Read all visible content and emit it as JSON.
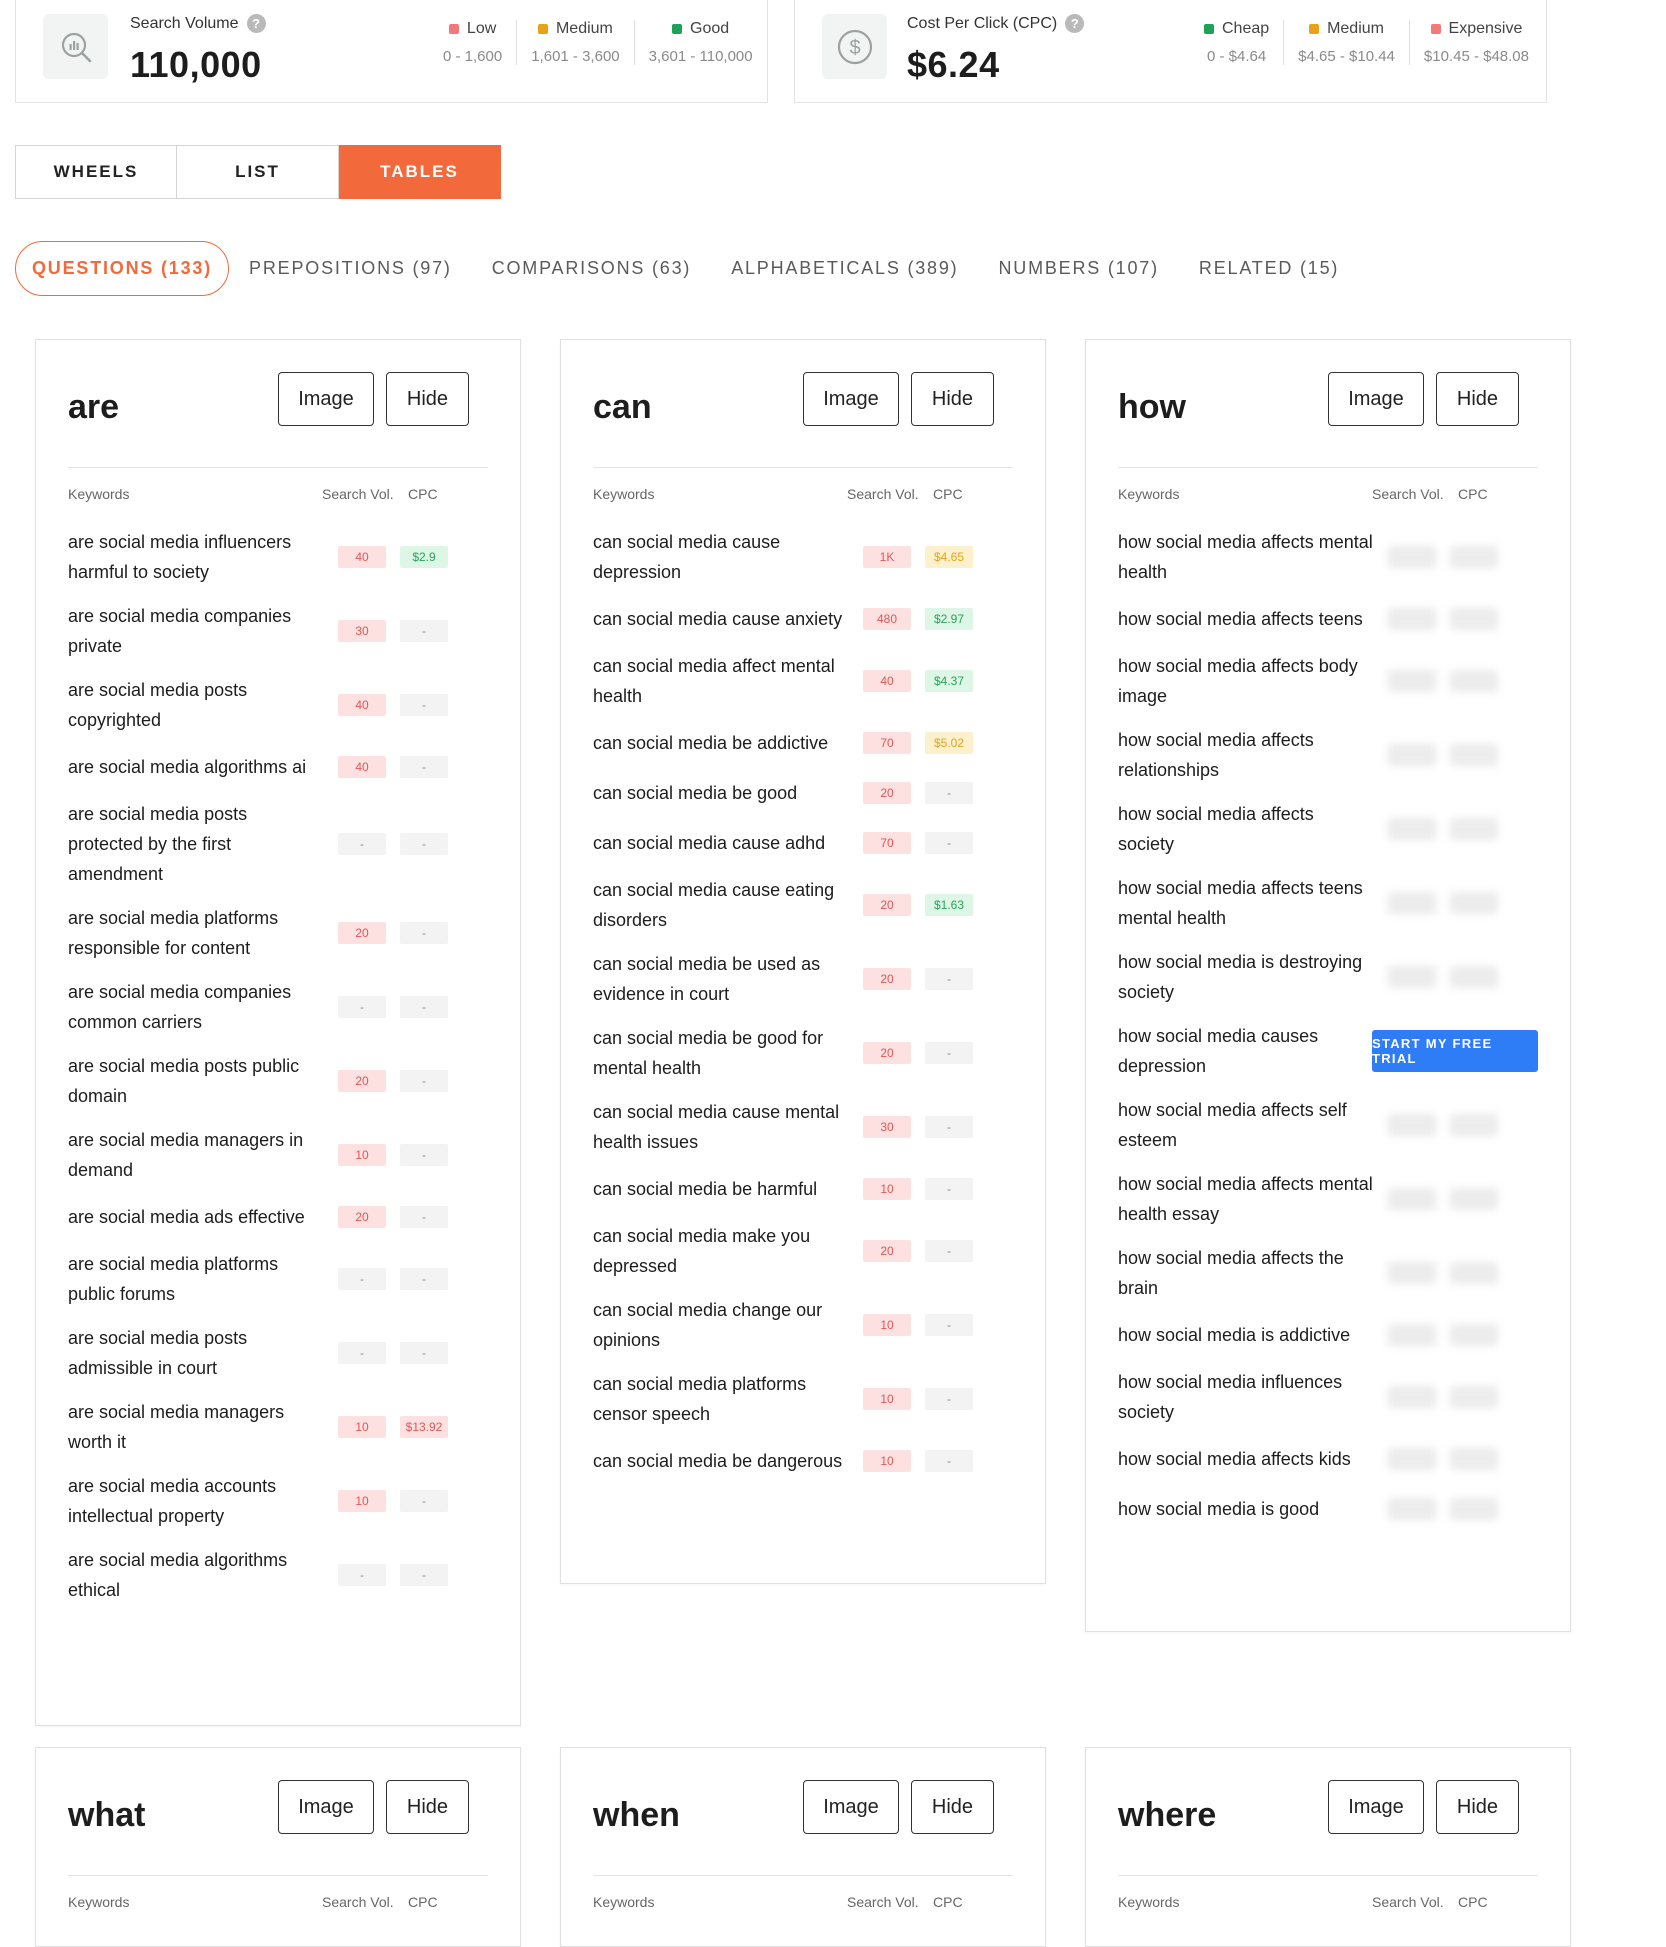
{
  "metrics": {
    "search_volume": {
      "label": "Search Volume",
      "value": "110,000",
      "legend": [
        {
          "name": "Low",
          "range": "0 - 1,600",
          "color": "#f07a7a"
        },
        {
          "name": "Medium",
          "range": "1,601 - 3,600",
          "color": "#e8a217"
        },
        {
          "name": "Good",
          "range": "3,601 - 110,000",
          "color": "#1fa257"
        }
      ]
    },
    "cpc": {
      "label": "Cost Per Click (CPC)",
      "value": "$6.24",
      "legend": [
        {
          "name": "Cheap",
          "range": "0 - $4.64",
          "color": "#1fa257"
        },
        {
          "name": "Medium",
          "range": "$4.65 - $10.44",
          "color": "#e8a217"
        },
        {
          "name": "Expensive",
          "range": "$10.45 - $48.08",
          "color": "#f07a7a"
        }
      ]
    }
  },
  "view_tabs": [
    "WHEELS",
    "LIST",
    "TABLES"
  ],
  "category_tabs": [
    "QUESTIONS (133)",
    "PREPOSITIONS (97)",
    "COMPARISONS (63)",
    "ALPHABETICALS (389)",
    "NUMBERS (107)",
    "RELATED (15)"
  ],
  "card_labels": {
    "image": "Image",
    "hide": "Hide",
    "keywords": "Keywords",
    "search_vol": "Search Vol.",
    "cpc": "CPC"
  },
  "trial_button": "START MY FREE TRIAL",
  "cards": [
    {
      "title": "are",
      "rows": [
        {
          "kw": "are social media influencers harmful to society",
          "vol": "40",
          "vol_c": "red",
          "cpc": "$2.9",
          "cpc_c": "green"
        },
        {
          "kw": "are social media companies private",
          "vol": "30",
          "vol_c": "red",
          "cpc": "-",
          "cpc_c": "none"
        },
        {
          "kw": "are social media posts copyrighted",
          "vol": "40",
          "vol_c": "red",
          "cpc": "-",
          "cpc_c": "none"
        },
        {
          "kw": "are social media algorithms ai",
          "vol": "40",
          "vol_c": "red",
          "cpc": "-",
          "cpc_c": "none"
        },
        {
          "kw": "are social media posts protected by the first amendment",
          "vol": "-",
          "vol_c": "none",
          "cpc": "-",
          "cpc_c": "none"
        },
        {
          "kw": "are social media platforms responsible for content",
          "vol": "20",
          "vol_c": "red",
          "cpc": "-",
          "cpc_c": "none"
        },
        {
          "kw": "are social media companies common carriers",
          "vol": "-",
          "vol_c": "none",
          "cpc": "-",
          "cpc_c": "none"
        },
        {
          "kw": "are social media posts public domain",
          "vol": "20",
          "vol_c": "red",
          "cpc": "-",
          "cpc_c": "none"
        },
        {
          "kw": "are social media managers in demand",
          "vol": "10",
          "vol_c": "red",
          "cpc": "-",
          "cpc_c": "none"
        },
        {
          "kw": "are social media ads effective",
          "vol": "20",
          "vol_c": "red",
          "cpc": "-",
          "cpc_c": "none"
        },
        {
          "kw": "are social media platforms public forums",
          "vol": "-",
          "vol_c": "none",
          "cpc": "-",
          "cpc_c": "none"
        },
        {
          "kw": "are social media posts admissible in court",
          "vol": "-",
          "vol_c": "none",
          "cpc": "-",
          "cpc_c": "none"
        },
        {
          "kw": "are social media managers worth it",
          "vol": "10",
          "vol_c": "red",
          "cpc": "$13.92",
          "cpc_c": "red"
        },
        {
          "kw": "are social media accounts intellectual property",
          "vol": "10",
          "vol_c": "red",
          "cpc": "-",
          "cpc_c": "none"
        },
        {
          "kw": "are social media algorithms ethical",
          "vol": "-",
          "vol_c": "none",
          "cpc": "-",
          "cpc_c": "none"
        }
      ]
    },
    {
      "title": "can",
      "rows": [
        {
          "kw": "can social media cause depression",
          "vol": "1K",
          "vol_c": "red",
          "cpc": "$4.65",
          "cpc_c": "yellow"
        },
        {
          "kw": "can social media cause anxiety",
          "vol": "480",
          "vol_c": "red",
          "cpc": "$2.97",
          "cpc_c": "green"
        },
        {
          "kw": "can social media affect mental health",
          "vol": "40",
          "vol_c": "red",
          "cpc": "$4.37",
          "cpc_c": "green"
        },
        {
          "kw": "can social media be addictive",
          "vol": "70",
          "vol_c": "red",
          "cpc": "$5.02",
          "cpc_c": "yellow"
        },
        {
          "kw": "can social media be good",
          "vol": "20",
          "vol_c": "red",
          "cpc": "-",
          "cpc_c": "none"
        },
        {
          "kw": "can social media cause adhd",
          "vol": "70",
          "vol_c": "red",
          "cpc": "-",
          "cpc_c": "none"
        },
        {
          "kw": "can social media cause eating disorders",
          "vol": "20",
          "vol_c": "red",
          "cpc": "$1.63",
          "cpc_c": "green"
        },
        {
          "kw": "can social media be used as evidence in court",
          "vol": "20",
          "vol_c": "red",
          "cpc": "-",
          "cpc_c": "none"
        },
        {
          "kw": "can social media be good for mental health",
          "vol": "20",
          "vol_c": "red",
          "cpc": "-",
          "cpc_c": "none"
        },
        {
          "kw": "can social media cause mental health issues",
          "vol": "30",
          "vol_c": "red",
          "cpc": "-",
          "cpc_c": "none"
        },
        {
          "kw": "can social media be harmful",
          "vol": "10",
          "vol_c": "red",
          "cpc": "-",
          "cpc_c": "none"
        },
        {
          "kw": "can social media make you depressed",
          "vol": "20",
          "vol_c": "red",
          "cpc": "-",
          "cpc_c": "none"
        },
        {
          "kw": "can social media change our opinions",
          "vol": "10",
          "vol_c": "red",
          "cpc": "-",
          "cpc_c": "none"
        },
        {
          "kw": "can social media platforms censor speech",
          "vol": "10",
          "vol_c": "red",
          "cpc": "-",
          "cpc_c": "none"
        },
        {
          "kw": "can social media be dangerous",
          "vol": "10",
          "vol_c": "red",
          "cpc": "-",
          "cpc_c": "none"
        }
      ]
    },
    {
      "title": "how",
      "rows": [
        {
          "kw": "how social media affects mental health",
          "vol": "",
          "vol_c": "blur",
          "cpc": "",
          "cpc_c": "blur"
        },
        {
          "kw": "how social media affects teens",
          "vol": "",
          "vol_c": "blur",
          "cpc": "",
          "cpc_c": "blur"
        },
        {
          "kw": "how social media affects body image",
          "vol": "",
          "vol_c": "blur",
          "cpc": "",
          "cpc_c": "blur"
        },
        {
          "kw": "how social media affects relationships",
          "vol": "",
          "vol_c": "blur",
          "cpc": "",
          "cpc_c": "blur"
        },
        {
          "kw": "how social media affects society",
          "vol": "",
          "vol_c": "blur",
          "cpc": "",
          "cpc_c": "blur"
        },
        {
          "kw": "how social media affects teens mental health",
          "vol": "",
          "vol_c": "blur",
          "cpc": "",
          "cpc_c": "blur"
        },
        {
          "kw": "how social media is destroying society",
          "vol": "",
          "vol_c": "blur",
          "cpc": "",
          "cpc_c": "blur"
        },
        {
          "kw": "how social media causes depression",
          "vol": "",
          "vol_c": "blur",
          "cpc": "",
          "cpc_c": "blur"
        },
        {
          "kw": "how social media affects self esteem",
          "vol": "",
          "vol_c": "blur",
          "cpc": "",
          "cpc_c": "blur"
        },
        {
          "kw": "how social media affects mental health essay",
          "vol": "",
          "vol_c": "blur",
          "cpc": "",
          "cpc_c": "blur"
        },
        {
          "kw": "how social media affects the brain",
          "vol": "",
          "vol_c": "blur",
          "cpc": "",
          "cpc_c": "blur"
        },
        {
          "kw": "how social media is addictive",
          "vol": "",
          "vol_c": "blur",
          "cpc": "",
          "cpc_c": "blur"
        },
        {
          "kw": "how social media influences society",
          "vol": "",
          "vol_c": "blur",
          "cpc": "",
          "cpc_c": "blur"
        },
        {
          "kw": "how social media affects kids",
          "vol": "",
          "vol_c": "blur",
          "cpc": "",
          "cpc_c": "blur"
        },
        {
          "kw": "how social media is good",
          "vol": "",
          "vol_c": "blur",
          "cpc": "",
          "cpc_c": "blur"
        }
      ]
    },
    {
      "title": "what",
      "rows": []
    },
    {
      "title": "when",
      "rows": []
    },
    {
      "title": "where",
      "rows": []
    }
  ]
}
